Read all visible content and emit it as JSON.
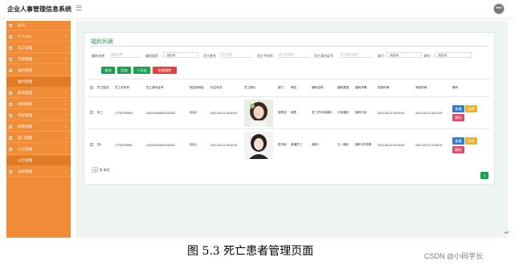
{
  "app_title": "企业人事管理信息系统",
  "sidebar": {
    "items": [
      {
        "label": "首页",
        "has_arrow": false
      },
      {
        "label": "个人中心",
        "has_arrow": true
      },
      {
        "label": "员工管理",
        "has_arrow": true
      },
      {
        "label": "考勤管理",
        "has_arrow": true
      },
      {
        "label": "福利管理",
        "has_arrow": true
      },
      {
        "label": "福利管理",
        "has_arrow": false,
        "sub": true
      },
      {
        "label": "薪资管理",
        "has_arrow": true
      },
      {
        "label": "培训管理",
        "has_arrow": true
      },
      {
        "label": "考核管理",
        "has_arrow": true
      },
      {
        "label": "招聘管理",
        "has_arrow": true
      },
      {
        "label": "部门管理",
        "has_arrow": true
      },
      {
        "label": "公告管理",
        "has_arrow": true
      },
      {
        "label": "公告管理",
        "has_arrow": false,
        "sub": true
      },
      {
        "label": "系统管理",
        "has_arrow": true
      }
    ]
  },
  "panel": {
    "title": "福利列表",
    "filters": {
      "welfare_name": {
        "label": "福利名称",
        "placeholder": "福利名称"
      },
      "welfare_type": {
        "label": "福利类型",
        "value": "-请选择-"
      },
      "emp_name": {
        "label": "员工姓名",
        "placeholder": "员工姓名"
      },
      "emp_phone": {
        "label": "员工手机号",
        "placeholder": "员工手机号"
      },
      "emp_id": {
        "label": "员工身份证号",
        "placeholder": "员工身份证号"
      },
      "dept": {
        "label": "部门",
        "value": "-请选择-"
      },
      "position": {
        "label": "职位",
        "value": "-请选择-"
      }
    },
    "buttons": {
      "query": "查询",
      "add": "添加",
      "export": "导出",
      "batch_delete": "批量删除"
    }
  },
  "table": {
    "headers": [
      "员工姓名",
      "员工手机号",
      "员工身份证号",
      "现住房地址",
      "出生年月",
      "员工照片",
      "部门",
      "职位",
      "福利名称",
      "福利类型",
      "福利详情",
      "发放时间",
      "添加时间",
      "操作"
    ],
    "rows": [
      {
        "cells": [
          "张三",
          "17703790903",
          "410224199610232002",
          "地址2",
          "2021-05-21 00:00:00",
          "",
          "销售部",
          "销售",
          "张三的中秋福利",
          "中秋福利",
          "福利内容",
          "2021-05-22 00:00:00",
          "2021-05-21 15:21:00"
        ],
        "photo": "photo-1",
        "actions": {
          "view": "查看",
          "edit": "修改",
          "delete": "删除"
        }
      },
      {
        "cells": [
          "张1",
          "17703790901",
          "410224199610232001",
          "地址1",
          "2021-05-21 00:00:00",
          "",
          "财务部",
          "普通员工",
          "福利1",
          "五一福利",
          "福利1的详情",
          "2021-05-20 00:00:00",
          "2021-05-21 13:36:00"
        ],
        "photo": "photo-2",
        "actions": {
          "view": "查看",
          "edit": "修改",
          "delete": "删除"
        }
      }
    ]
  },
  "pager": {
    "size": "10",
    "size_suffix": "条 每页",
    "page": "1"
  },
  "caption": "图 5.3 死亡患者管理页面",
  "watermark": "CSDN @小码学长",
  "colors": {
    "sidebar": "#f08c37",
    "primary_green": "#1e9e50",
    "danger": "#e4403d"
  }
}
